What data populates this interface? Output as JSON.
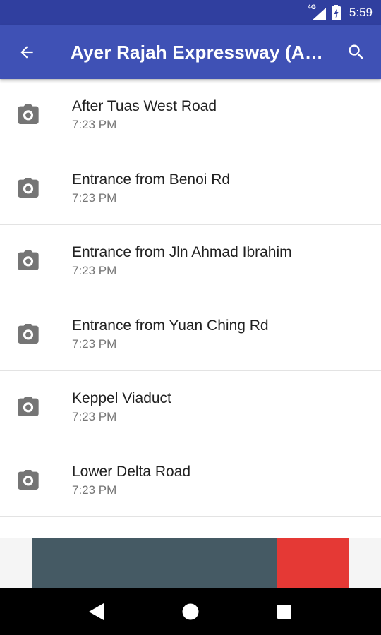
{
  "status_bar": {
    "network": "4G",
    "time": "5:59",
    "icons": [
      "signal-icon",
      "battery-charging-icon"
    ]
  },
  "app_bar": {
    "title": "Ayer Rajah Expressway (A…",
    "back_icon": "arrow-back-icon",
    "search_icon": "search-icon"
  },
  "cameras": [
    {
      "name": "After Tuas West Road",
      "time": "7:23 PM"
    },
    {
      "name": "Entrance from Benoi Rd",
      "time": "7:23 PM"
    },
    {
      "name": "Entrance from Jln Ahmad Ibrahim",
      "time": "7:23 PM"
    },
    {
      "name": "Entrance from Yuan Ching Rd",
      "time": "7:23 PM"
    },
    {
      "name": "Keppel Viaduct",
      "time": "7:23 PM"
    },
    {
      "name": "Lower Delta Road",
      "time": "7:23 PM"
    }
  ],
  "nav_bar": {
    "icons": [
      "back-triangle-icon",
      "home-circle-icon",
      "recents-square-icon"
    ]
  },
  "colors": {
    "status_bar": "#303f9f",
    "app_bar": "#3f51b5",
    "ad_banner": "#455a64",
    "ad_accent": "#e53935"
  }
}
